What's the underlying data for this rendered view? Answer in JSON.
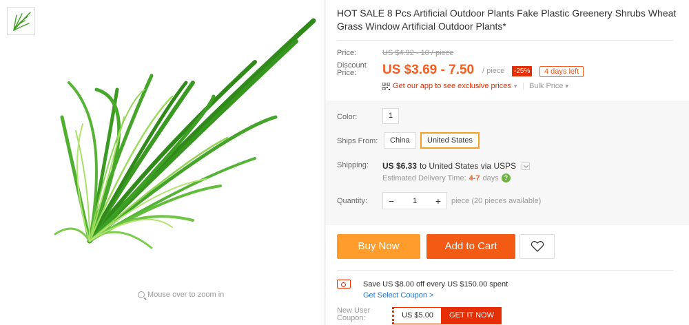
{
  "gallery": {
    "zoom_hint": "Mouse over to zoom in"
  },
  "product": {
    "title": "HOT SALE 8 Pcs Artificial Outdoor Plants Fake Plastic Greenery Shrubs Wheat Grass Window Artificial Outdoor Plants*"
  },
  "price": {
    "label": "Price:",
    "original": "US $4.92 - 10 / piece",
    "discount_label": "Discount Price:",
    "discount_value": "US $3.69 - 7.50",
    "per_unit": "/ piece",
    "discount_pct": "-25%",
    "days_left": "4 days left",
    "app_promo": "Get our app to see exclusive prices",
    "bulk": "Bulk Price"
  },
  "sku": {
    "color_label": "Color:",
    "color_value": "1",
    "ships_from_label": "Ships From:",
    "ships_from_options": [
      "China",
      "United States"
    ],
    "ships_from_selected": "United States",
    "shipping_label": "Shipping:",
    "shipping_cost": "US $6.33",
    "shipping_rest": "to United States via USPS",
    "delivery_text": "Estimated Delivery Time:",
    "delivery_days": "4-7",
    "delivery_unit": "days",
    "quantity_label": "Quantity:",
    "quantity_value": "1",
    "quantity_note": "piece (20 pieces available)"
  },
  "actions": {
    "buy_now": "Buy Now",
    "add_to_cart": "Add to Cart"
  },
  "coupon": {
    "save_text": "Save US $8.00 off every US $150.00 spent",
    "link": "Get Select Coupon >",
    "new_user_label": "New User Coupon:",
    "value": "US $5.00",
    "cta": "GET IT NOW"
  },
  "colors": {
    "accent": "#f55d22",
    "buy_now": "#ff9c2b",
    "add_to_cart": "#f35a14",
    "badge_red": "#e62e04",
    "link_blue": "#2a74c9",
    "plant_green": "#3fa020"
  },
  "icons": [
    "magnifier-icon",
    "qr-code-icon",
    "chevron-down-icon",
    "help-icon",
    "heart-icon",
    "coupon-icon"
  ]
}
